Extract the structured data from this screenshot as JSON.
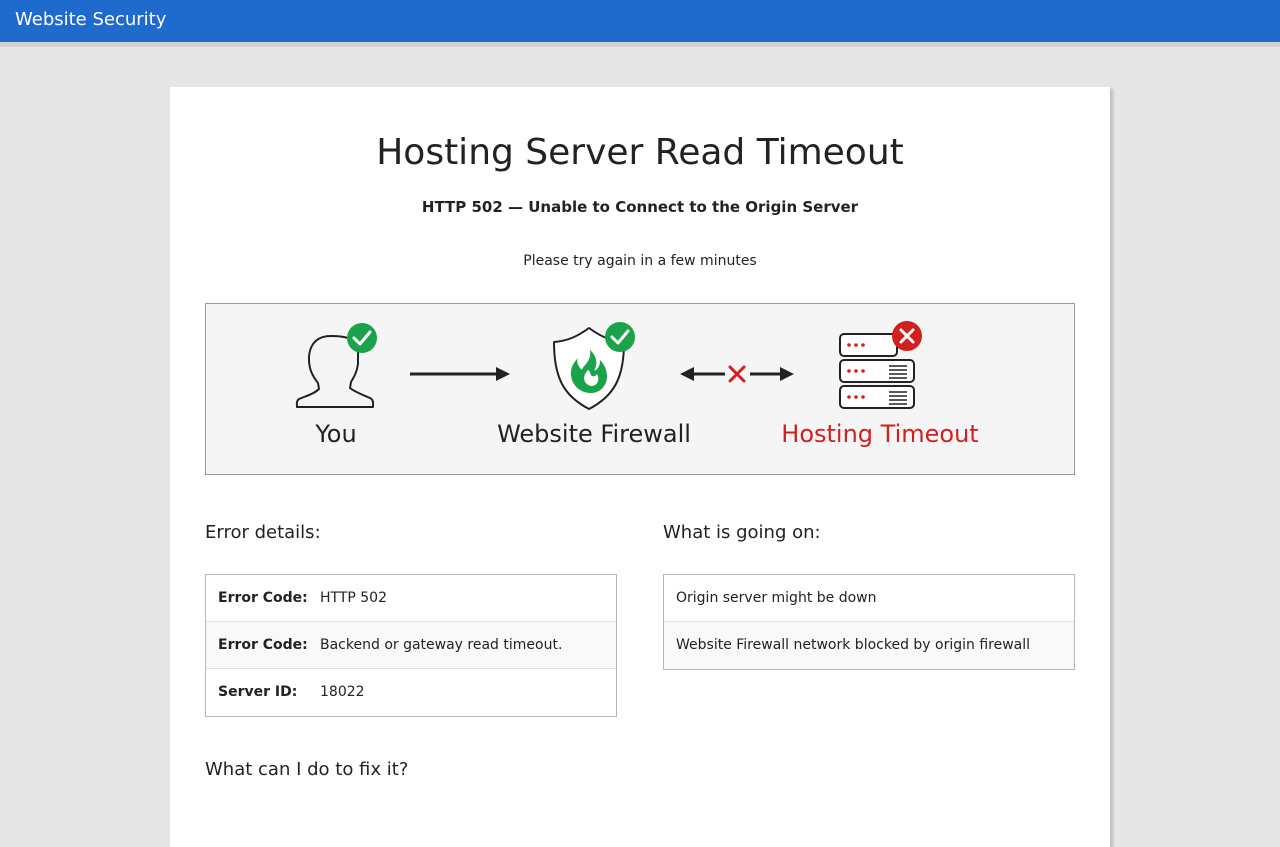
{
  "app": {
    "title": "Website Security"
  },
  "page": {
    "title": "Hosting Server Read Timeout",
    "subtitle": "HTTP 502 — Unable to Connect to the Origin Server",
    "note": "Please try again in a few minutes"
  },
  "diagram": {
    "nodes": [
      {
        "label": "You",
        "icon": "user-icon",
        "status": "ok"
      },
      {
        "label": "Website Firewall",
        "icon": "firewall-shield-icon",
        "status": "ok"
      },
      {
        "label": "Hosting Timeout",
        "icon": "server-stack-icon",
        "status": "error"
      }
    ],
    "colors": {
      "ok": "#1aa34a",
      "error": "#d21f1f",
      "line": "#222222"
    }
  },
  "error_details": {
    "heading": "Error details:",
    "rows": [
      {
        "key": "Error Code:",
        "value": "HTTP 502"
      },
      {
        "key": "Error Code:",
        "value": "Backend or gateway read timeout."
      },
      {
        "key": "Server ID:",
        "value": "18022"
      }
    ]
  },
  "whats_going_on": {
    "heading": "What is going on:",
    "rows": [
      "Origin server might be down",
      "Website Firewall network blocked by origin firewall"
    ]
  },
  "fix": {
    "heading": "What can I do to fix it?"
  },
  "theme": {
    "header_bg": "#1e6acd",
    "page_bg": "#e6e6e6"
  }
}
